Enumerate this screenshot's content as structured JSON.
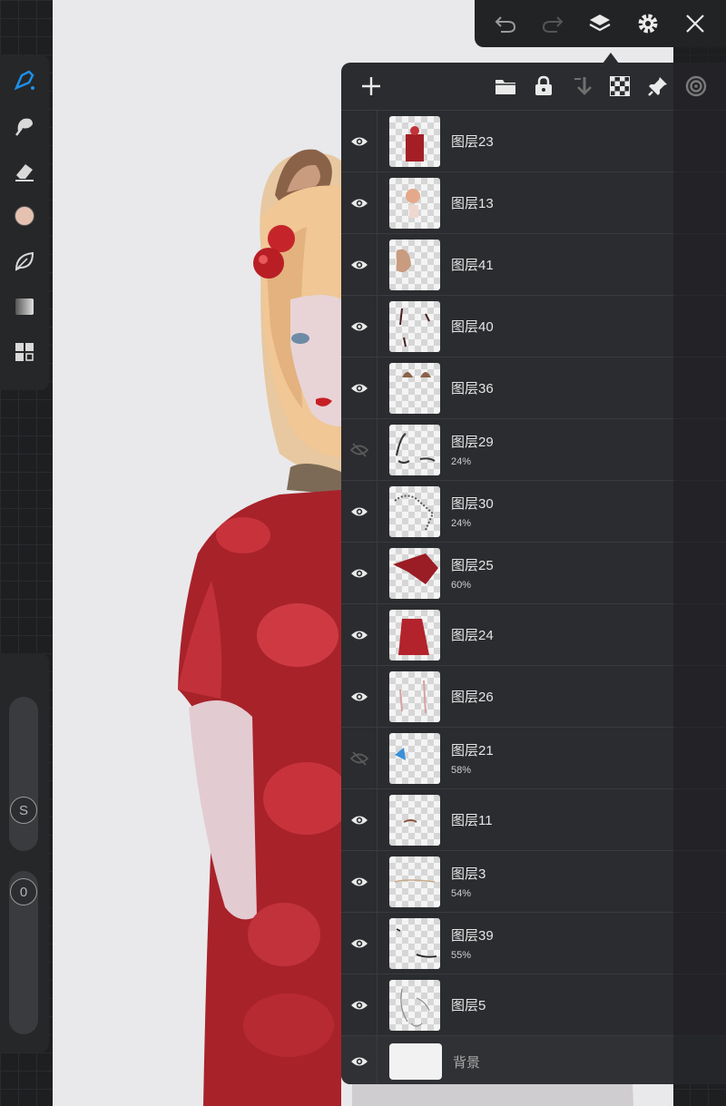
{
  "top_toolbar": {
    "buttons": [
      "undo-icon",
      "redo-icon",
      "layers-icon",
      "settings-icon",
      "close-icon"
    ]
  },
  "left_toolbar": {
    "tools": [
      "brush-icon",
      "smudge-icon",
      "eraser-icon",
      "color-swatch",
      "leaf-icon",
      "gradient-icon",
      "grid-icon"
    ],
    "color": "#e4c1b0",
    "accent": "#1e8fe6",
    "size_slider_label": "S",
    "opacity_slider_label": "0"
  },
  "layers_panel": {
    "toolbar": [
      "add-layer-icon",
      "folder-icon",
      "lock-icon",
      "merge-down-icon",
      "transparency-icon",
      "pin-icon",
      "target-icon"
    ],
    "layers": [
      {
        "name": "图层23",
        "opacity": "",
        "visible": true
      },
      {
        "name": "图层13",
        "opacity": "",
        "visible": true
      },
      {
        "name": "图层41",
        "opacity": "",
        "visible": true
      },
      {
        "name": "图层40",
        "opacity": "",
        "visible": true
      },
      {
        "name": "图层36",
        "opacity": "",
        "visible": true
      },
      {
        "name": "图层29",
        "opacity": "24%",
        "visible": false
      },
      {
        "name": "图层30",
        "opacity": "24%",
        "visible": true
      },
      {
        "name": "图层25",
        "opacity": "60%",
        "visible": true
      },
      {
        "name": "图层24",
        "opacity": "",
        "visible": true
      },
      {
        "name": "图层26",
        "opacity": "",
        "visible": true
      },
      {
        "name": "图层21",
        "opacity": "58%",
        "visible": false
      },
      {
        "name": "图层11",
        "opacity": "",
        "visible": true
      },
      {
        "name": "图层3",
        "opacity": "54%",
        "visible": true
      },
      {
        "name": "图层39",
        "opacity": "55%",
        "visible": true
      },
      {
        "name": "图层5",
        "opacity": "",
        "visible": true
      }
    ],
    "background_layer": {
      "name": "背景",
      "visible": true
    }
  }
}
